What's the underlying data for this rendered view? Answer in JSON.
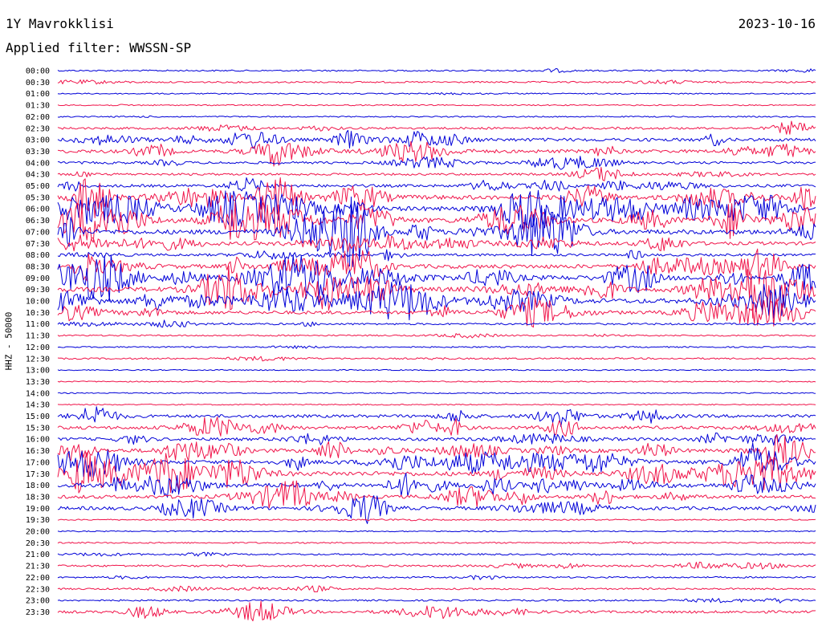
{
  "header": {
    "station": "1Y Mavrokklisi",
    "date": "2023-10-16",
    "filter": "Applied filter: WWSSN-SP"
  },
  "chart_data": {
    "type": "line",
    "subtype": "helicorder",
    "ylabel": "HHZ - 50000",
    "colors": [
      "#0000d8",
      "#f0144a"
    ],
    "rows": [
      {
        "label": "00:00",
        "activity": 0.12
      },
      {
        "label": "00:30",
        "activity": 0.15
      },
      {
        "label": "01:00",
        "activity": 0.05
      },
      {
        "label": "01:30",
        "activity": 0.04
      },
      {
        "label": "02:00",
        "activity": 0.06
      },
      {
        "label": "02:30",
        "activity": 0.3
      },
      {
        "label": "03:00",
        "activity": 0.55
      },
      {
        "label": "03:30",
        "activity": 0.6
      },
      {
        "label": "04:00",
        "activity": 0.35
      },
      {
        "label": "04:30",
        "activity": 0.3
      },
      {
        "label": "05:00",
        "activity": 0.45
      },
      {
        "label": "05:30",
        "activity": 0.85
      },
      {
        "label": "06:00",
        "activity": 0.9
      },
      {
        "label": "06:30",
        "activity": 0.9
      },
      {
        "label": "07:00",
        "activity": 0.9
      },
      {
        "label": "07:30",
        "activity": 0.6
      },
      {
        "label": "08:00",
        "activity": 0.35
      },
      {
        "label": "08:30",
        "activity": 0.75
      },
      {
        "label": "09:00",
        "activity": 0.95
      },
      {
        "label": "09:30",
        "activity": 0.95
      },
      {
        "label": "10:00",
        "activity": 0.9
      },
      {
        "label": "10:30",
        "activity": 0.6
      },
      {
        "label": "11:00",
        "activity": 0.22
      },
      {
        "label": "11:30",
        "activity": 0.12
      },
      {
        "label": "12:00",
        "activity": 0.08
      },
      {
        "label": "12:30",
        "activity": 0.15
      },
      {
        "label": "13:00",
        "activity": 0.03
      },
      {
        "label": "13:30",
        "activity": 0.03
      },
      {
        "label": "14:00",
        "activity": 0.03
      },
      {
        "label": "14:30",
        "activity": 0.03
      },
      {
        "label": "15:00",
        "activity": 0.5
      },
      {
        "label": "15:30",
        "activity": 0.55
      },
      {
        "label": "16:00",
        "activity": 0.5
      },
      {
        "label": "16:30",
        "activity": 0.7
      },
      {
        "label": "17:00",
        "activity": 0.75
      },
      {
        "label": "17:30",
        "activity": 0.85
      },
      {
        "label": "18:00",
        "activity": 0.8
      },
      {
        "label": "18:30",
        "activity": 0.6
      },
      {
        "label": "19:00",
        "activity": 0.6
      },
      {
        "label": "19:30",
        "activity": 0.06
      },
      {
        "label": "20:00",
        "activity": 0.03
      },
      {
        "label": "20:30",
        "activity": 0.1
      },
      {
        "label": "21:00",
        "activity": 0.15
      },
      {
        "label": "21:30",
        "activity": 0.25
      },
      {
        "label": "22:00",
        "activity": 0.15
      },
      {
        "label": "22:30",
        "activity": 0.18
      },
      {
        "label": "23:00",
        "activity": 0.15
      },
      {
        "label": "23:30",
        "activity": 0.4
      }
    ]
  }
}
